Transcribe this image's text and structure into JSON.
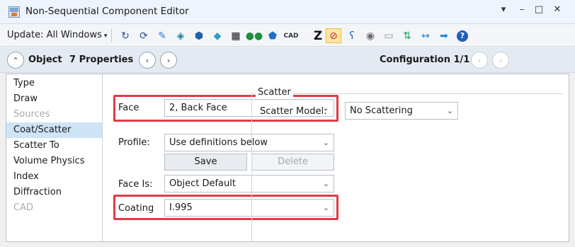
{
  "window": {
    "title": "Non-Sequential Component Editor",
    "controls": {
      "menu": "▾",
      "minimize": "–",
      "maximize": "□",
      "close": "✕"
    }
  },
  "toolbar": {
    "update_label": "Update: All Windows",
    "update_caret": "▾",
    "icons": [
      {
        "name": "rotate-icon",
        "glyph": "↻",
        "color": "#2b4f86"
      },
      {
        "name": "rotate-all-icon",
        "glyph": "⟳",
        "color": "#2b4f86"
      },
      {
        "name": "ray-trace-icon",
        "glyph": "✎",
        "color": "#3a7bd5"
      },
      {
        "name": "source-icon",
        "glyph": "◈",
        "color": "#1f7f9e"
      },
      {
        "name": "object-icon",
        "glyph": "⬢",
        "color": "#1f5fa8"
      },
      {
        "name": "detector-icon",
        "glyph": "◆",
        "color": "#2aa0c4"
      },
      {
        "name": "grid-icon",
        "glyph": "▦",
        "color": "#111111"
      },
      {
        "name": "lens-icon",
        "glyph": "●●",
        "color": "#1f8f3e"
      },
      {
        "name": "shape-icon",
        "glyph": "⬟",
        "color": "#1f6fc2"
      },
      {
        "name": "cad-icon",
        "glyph": "CAD",
        "color": "#333333"
      },
      {
        "name": "z-icon",
        "glyph": "Z",
        "color": "#111111"
      },
      {
        "name": "no-icon",
        "glyph": "⊘",
        "color": "#d6262e"
      },
      {
        "name": "curve-icon",
        "glyph": "ʕ",
        "color": "#1f5fa8"
      },
      {
        "name": "toggle-icon",
        "glyph": "◉",
        "color": "#6b6b6b"
      },
      {
        "name": "page-icon",
        "glyph": "▭",
        "color": "#8c8c8c"
      },
      {
        "name": "swap-icon",
        "glyph": "⇅",
        "color": "#1f9e5b"
      },
      {
        "name": "arrows-icon",
        "glyph": "↔",
        "color": "#1f8fd4"
      },
      {
        "name": "right-arrow-icon",
        "glyph": "➡",
        "color": "#1f8fd4"
      },
      {
        "name": "help-icon",
        "glyph": "?",
        "color": "#ffffff"
      }
    ]
  },
  "header": {
    "collapse_glyph": "⌃",
    "object_label": "Object",
    "properties_label": "7 Properties",
    "prev_glyph": "‹",
    "next_glyph": "›",
    "config_label": "Configuration 1/1"
  },
  "nav": {
    "items": [
      {
        "label": "Type",
        "state": "normal"
      },
      {
        "label": "Draw",
        "state": "normal"
      },
      {
        "label": "Sources",
        "state": "dim"
      },
      {
        "label": "Coat/Scatter",
        "state": "active"
      },
      {
        "label": "Scatter To",
        "state": "normal"
      },
      {
        "label": "Volume Physics",
        "state": "normal"
      },
      {
        "label": "Index",
        "state": "normal"
      },
      {
        "label": "Diffraction",
        "state": "normal"
      },
      {
        "label": "CAD",
        "state": "dim"
      }
    ]
  },
  "form": {
    "face_label": "Face",
    "face_value": "2, Back Face",
    "profile_label": "Profile:",
    "profile_value": "Use definitions below",
    "save_label": "Save",
    "delete_label": "Delete",
    "face_is_label": "Face Is:",
    "face_is_value": "Object Default",
    "coating_label": "Coating",
    "coating_value": "I.995",
    "chevron": "⌄"
  },
  "scatter": {
    "group_title": "Scatter",
    "model_label": "Scatter Model:",
    "model_value": "No Scattering"
  },
  "colors": {
    "highlight": "#e23a46",
    "active_nav": "#cfe3f6"
  }
}
